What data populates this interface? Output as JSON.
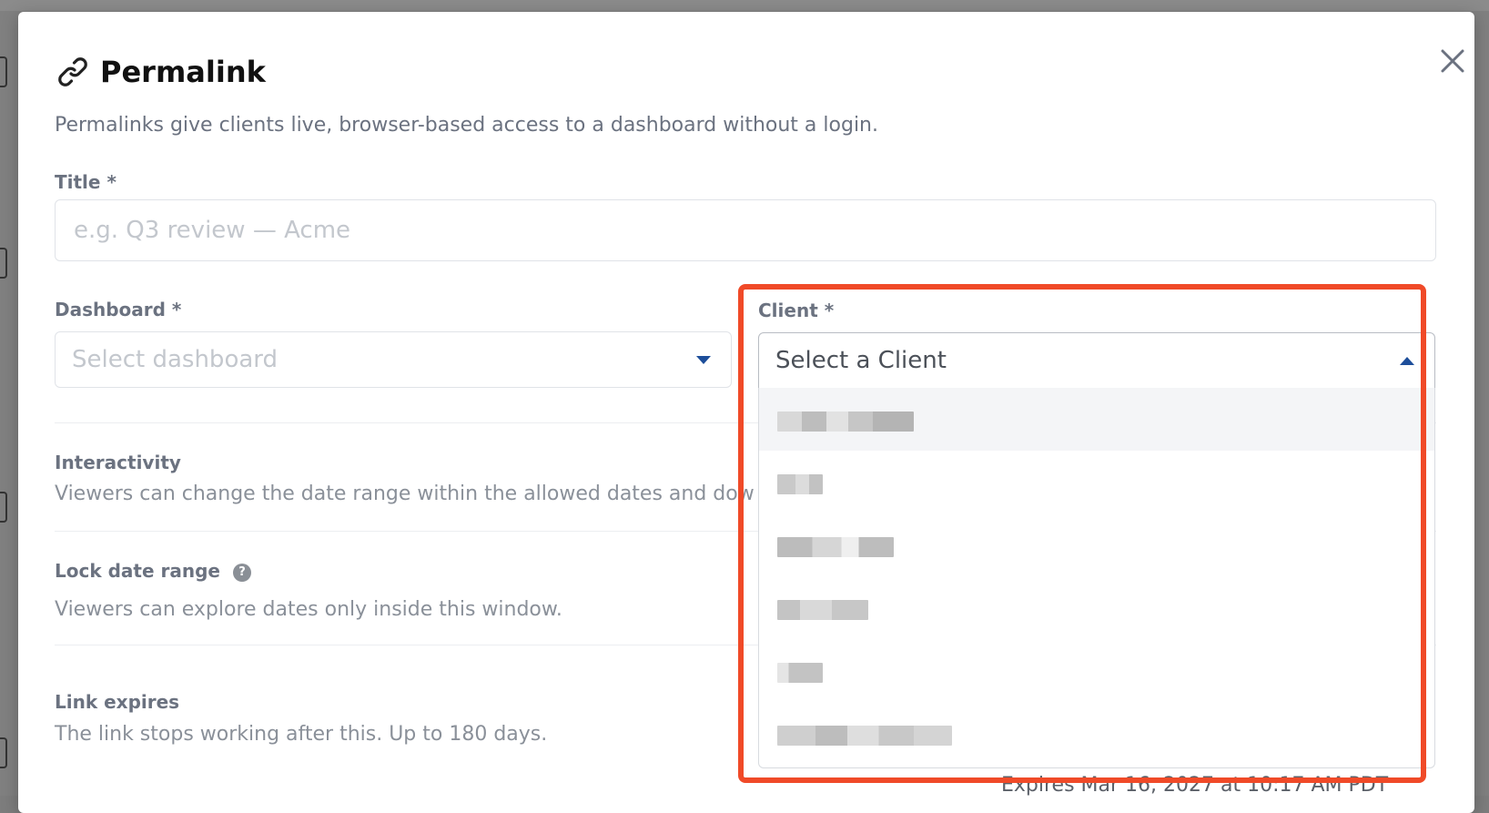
{
  "modal": {
    "title": "Permalink",
    "description": "Permalinks give clients live, browser-based access to a dashboard without a login.",
    "close_icon": "close-icon",
    "title_icon": "link-icon"
  },
  "form": {
    "title_label": "Title *",
    "title_placeholder": "e.g. Q3 review — Acme",
    "dashboard_label": "Dashboard *",
    "dashboard_placeholder": "Select dashboard",
    "client_label": "Client *",
    "client_placeholder": "Select a Client"
  },
  "sections": {
    "interactivity_title": "Interactivity",
    "interactivity_desc": "Viewers can change the date range within the allowed dates and dow",
    "lock_title": "Lock date range",
    "lock_desc": "Viewers can explore dates only inside this window.",
    "expires_title": "Link expires",
    "expires_desc": "The link stops working after this. Up to 180 days.",
    "expires_value": "Expires Mar 16, 2027 at 10:17 AM PDT"
  },
  "client_options_count_visible": 6,
  "colors": {
    "accent_caret": "#1d4e9a",
    "highlight_frame": "#f04a28",
    "option_hover": "#f4f5f7"
  }
}
